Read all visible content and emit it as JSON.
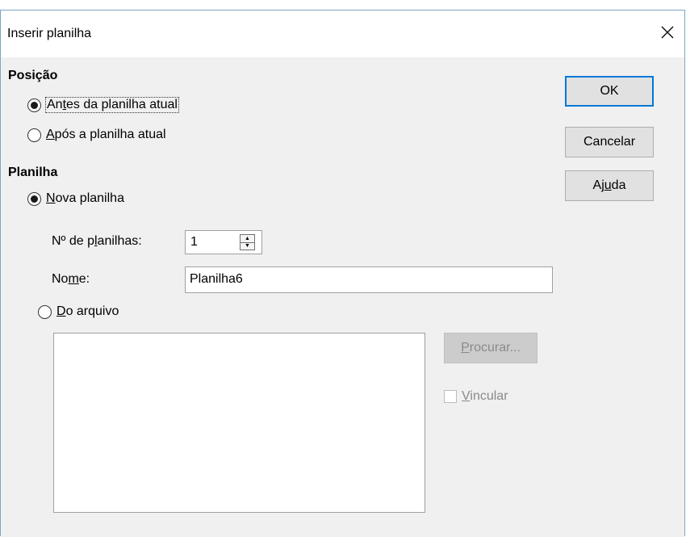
{
  "dialog": {
    "title": "Inserir planilha",
    "close_icon": "close-icon"
  },
  "position": {
    "heading": "Posição",
    "before": {
      "pre": "An",
      "mnemonic": "t",
      "post": "es da planilha atual",
      "selected": true
    },
    "after": {
      "pre": "",
      "mnemonic": "A",
      "post": "pós a planilha atual",
      "selected": false
    }
  },
  "sheet": {
    "heading": "Planilha",
    "new": {
      "pre": "",
      "mnemonic": "N",
      "post": "ova planilha",
      "selected": true
    },
    "count_label": {
      "pre": "Nº de p",
      "mnemonic": "l",
      "post": "anilhas:"
    },
    "count_value": "1",
    "name_label": {
      "pre": "No",
      "mnemonic": "m",
      "post": "e:"
    },
    "name_value": "Planilha6",
    "from_file": {
      "pre": "",
      "mnemonic": "D",
      "post": "o arquivo",
      "selected": false
    }
  },
  "buttons": {
    "ok": "OK",
    "cancel": "Cancelar",
    "help": {
      "pre": "Aj",
      "mnemonic": "u",
      "post": "da"
    },
    "browse": {
      "pre": "",
      "mnemonic": "P",
      "post": "rocurar..."
    }
  },
  "link": {
    "pre": "",
    "mnemonic": "V",
    "post": "incular",
    "checked": false,
    "enabled": false
  },
  "colors": {
    "accent": "#0078d7",
    "dialog_bg": "#f0f0f0",
    "disabled_text": "#8a8a8a"
  }
}
